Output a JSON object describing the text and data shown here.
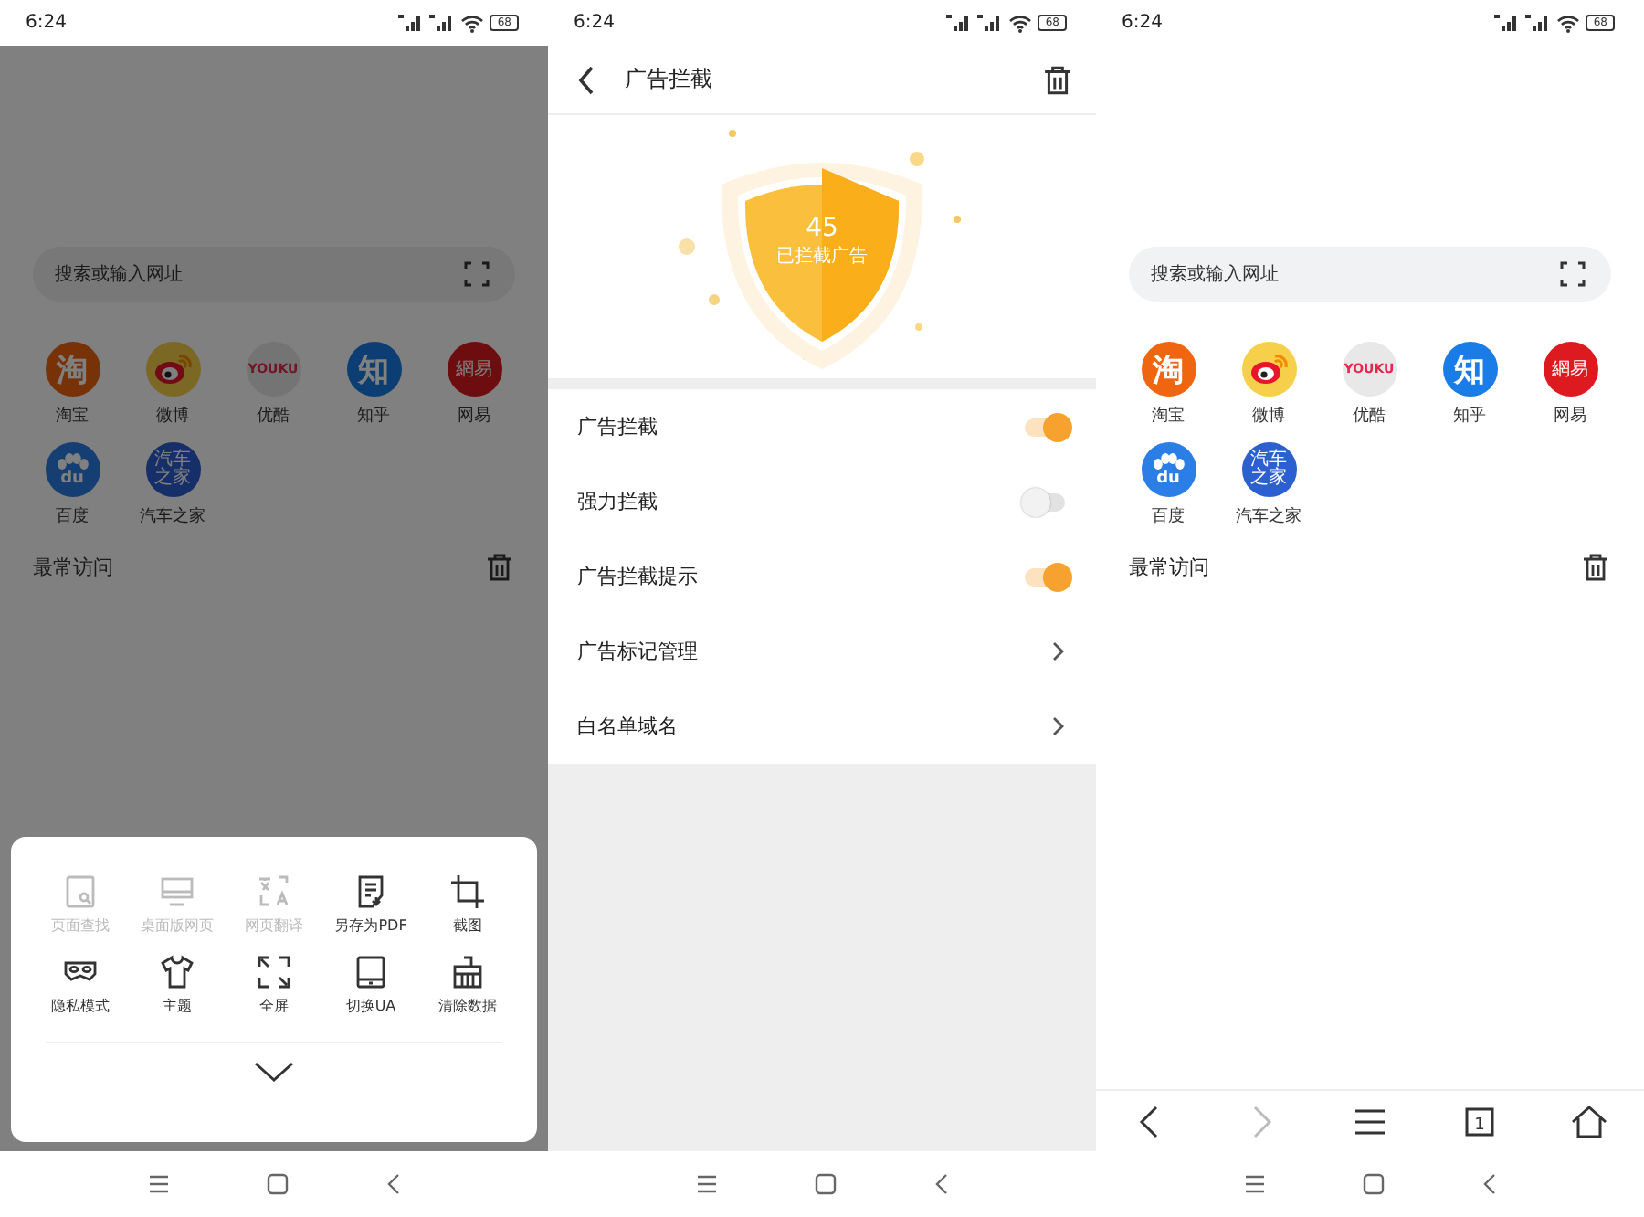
{
  "left_screen": {
    "status_bar": {
      "time": "6:24",
      "battery": "68"
    },
    "home": {
      "search": {
        "placeholder": "搜索或输入网址"
      },
      "sites": [
        {
          "name": "淘宝",
          "kind": "text",
          "logo": "淘",
          "color": "#783208"
        },
        {
          "name": "微博",
          "kind": "weibo",
          "color": "#7b6825"
        },
        {
          "name": "优酷",
          "kind": "small",
          "logo": "YOUKU",
          "color": "#747474"
        },
        {
          "name": "知乎",
          "kind": "text",
          "logo": "知",
          "color": "#0d3e73"
        },
        {
          "name": "网易",
          "kind": "text",
          "logo": "網易",
          "color": "#6e0d10"
        },
        {
          "name": "百度",
          "kind": "paw",
          "logo": "du",
          "color": "#153f72"
        },
        {
          "name": "汽车之家",
          "kind": "cjk",
          "logo": "汽车之家",
          "color": "#162f68"
        }
      ],
      "most_visited": {
        "title": "最常访问"
      }
    },
    "menu_sheet": {
      "items": [
        {
          "label": "页面查找",
          "kind": "find",
          "disabled": true
        },
        {
          "label": "桌面版网页",
          "kind": "desktop",
          "disabled": true
        },
        {
          "label": "网页翻译",
          "kind": "translate",
          "disabled": true
        },
        {
          "label": "另存为PDF",
          "kind": "pdf",
          "disabled": false
        },
        {
          "label": "截图",
          "kind": "crop",
          "disabled": false
        },
        {
          "label": "隐私模式",
          "kind": "mask",
          "disabled": false
        },
        {
          "label": "主题",
          "kind": "shirt",
          "disabled": false
        },
        {
          "label": "全屏",
          "kind": "fullscreen",
          "disabled": false
        },
        {
          "label": "切换UA",
          "kind": "tablet",
          "disabled": false
        },
        {
          "label": "清除数据",
          "kind": "broom",
          "disabled": false
        }
      ]
    }
  },
  "middle_screen": {
    "status_bar": {
      "time": "6:24",
      "battery": "68"
    },
    "header": {
      "title": "广告拦截"
    },
    "shield": {
      "count": "45",
      "caption": "已拦截广告"
    },
    "settings": [
      {
        "label": "广告拦截",
        "kind": "toggle",
        "on": true
      },
      {
        "label": "强力拦截",
        "kind": "toggle",
        "on": false
      },
      {
        "label": "广告拦截提示",
        "kind": "toggle",
        "on": true
      },
      {
        "label": "广告标记管理",
        "kind": "link"
      },
      {
        "label": "白名单域名",
        "kind": "link"
      }
    ]
  },
  "right_screen": {
    "status_bar": {
      "time": "6:24",
      "battery": "68"
    },
    "home": {
      "search": {
        "placeholder": "搜索或输入网址"
      },
      "sites": [
        {
          "name": "淘宝",
          "kind": "text",
          "logo": "淘",
          "color": "#f0650f"
        },
        {
          "name": "微博",
          "kind": "weibo",
          "color": "#f6d04a"
        },
        {
          "name": "优酷",
          "kind": "small",
          "logo": "YOUKU",
          "color": "#e8e8e8"
        },
        {
          "name": "知乎",
          "kind": "text",
          "logo": "知",
          "color": "#1a7ce6"
        },
        {
          "name": "网易",
          "kind": "text",
          "logo": "網易",
          "color": "#dd1a1f"
        },
        {
          "name": "百度",
          "kind": "paw",
          "logo": "du",
          "color": "#2a7ee5"
        },
        {
          "name": "汽车之家",
          "kind": "cjk",
          "logo": "汽车之家",
          "color": "#2c5fcf"
        }
      ],
      "most_visited": {
        "title": "最常访问"
      }
    },
    "toolbar": [
      {
        "kind": "back",
        "disabled": false
      },
      {
        "kind": "forward",
        "disabled": true
      },
      {
        "kind": "menu",
        "disabled": false
      },
      {
        "kind": "tabs",
        "count": "1",
        "disabled": false
      },
      {
        "kind": "home",
        "disabled": false
      }
    ]
  }
}
